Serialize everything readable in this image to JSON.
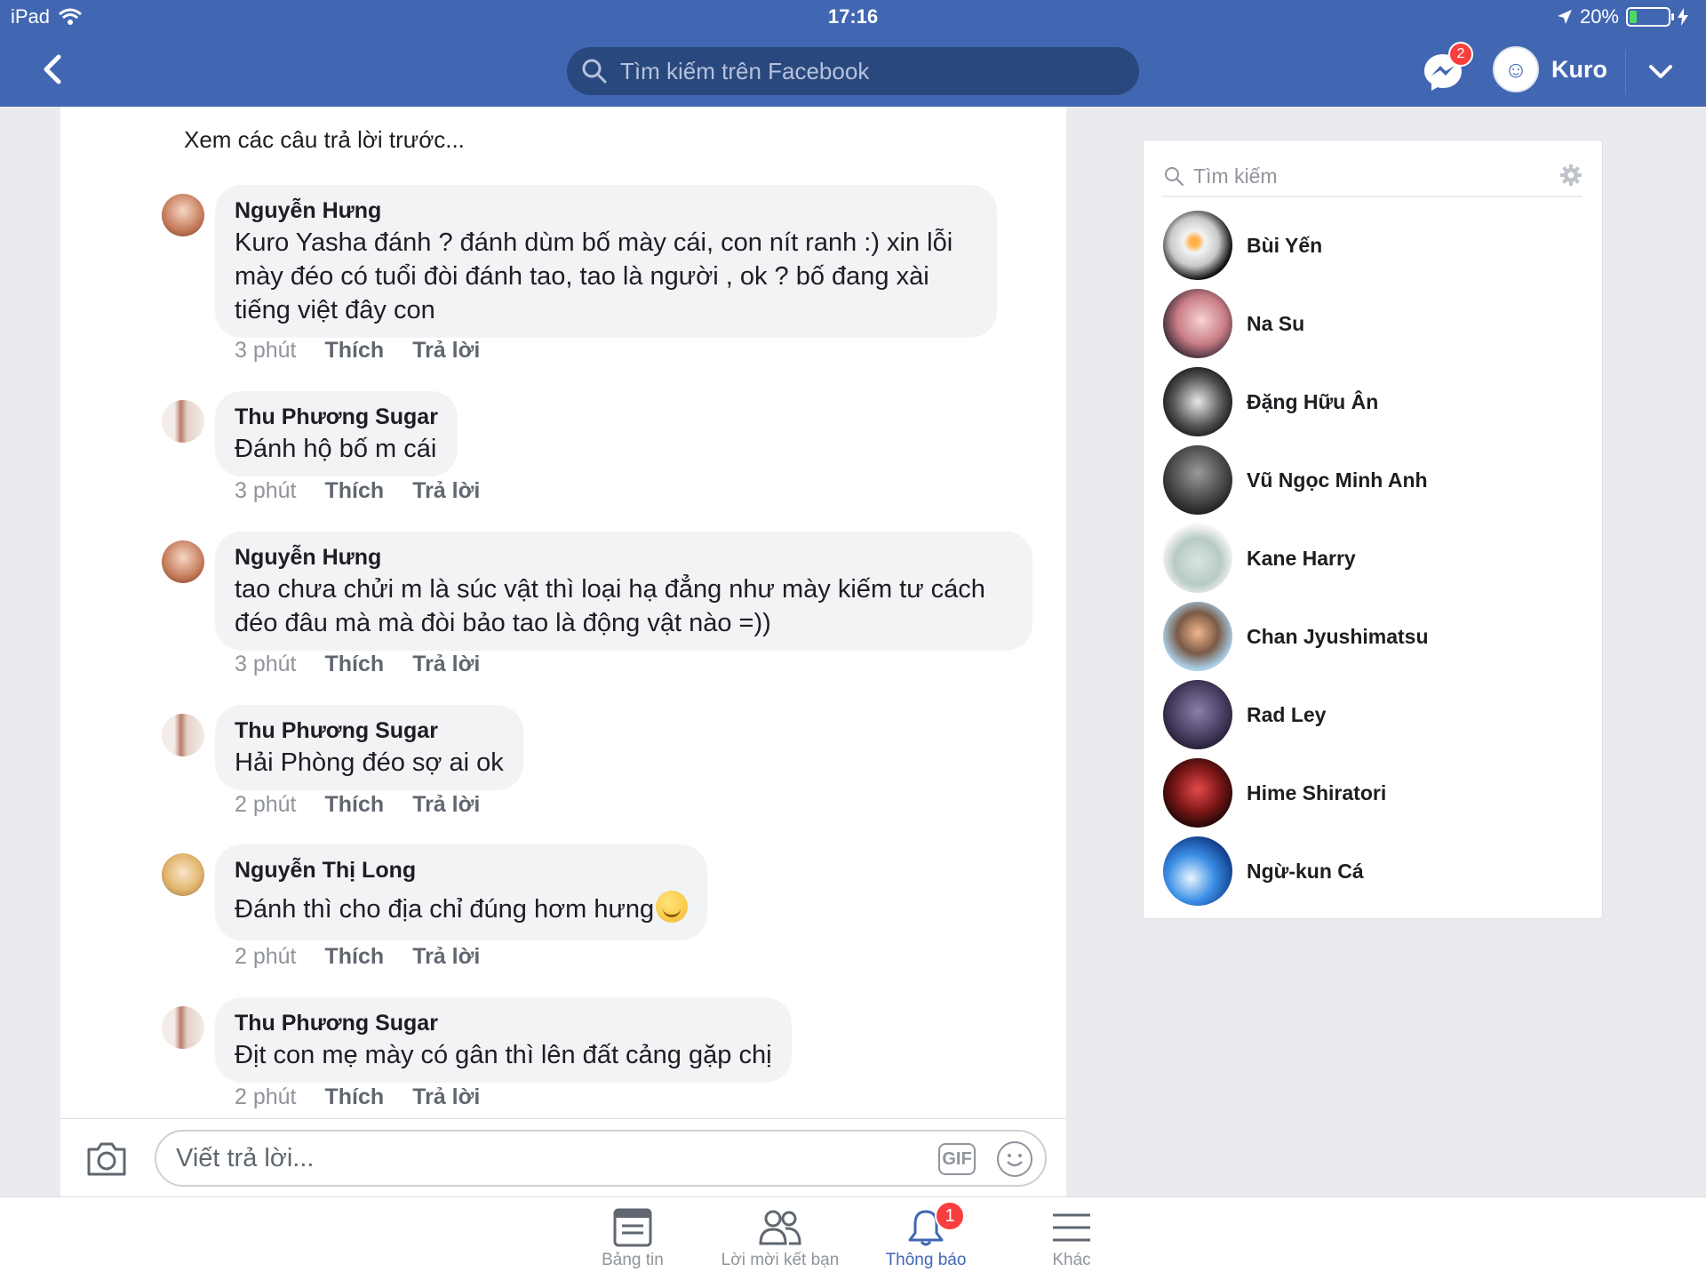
{
  "status": {
    "device": "iPad",
    "time": "17:16",
    "battery": "20%",
    "battery_level": 0.2
  },
  "nav": {
    "search_placeholder": "Tìm kiếm trên Facebook",
    "messenger_badge": "2",
    "profile_name": "Kuro"
  },
  "comments": {
    "view_previous": "Xem các câu trả lời trước...",
    "like_label": "Thích",
    "reply_label": "Trả lời",
    "items": [
      {
        "name": "Nguyễn Hưng",
        "text": "Kuro Yasha đánh ? đánh dùm bố mày cái, con nít ranh :) xin lỗi mày đéo có tuổi đòi đánh tao, tao là người , ok ?  bố đang xài tiếng việt đây con",
        "time": "3 phút"
      },
      {
        "name": "Thu Phương Sugar",
        "text": "Đánh hộ bố m cái",
        "time": "3 phút"
      },
      {
        "name": "Nguyễn Hưng",
        "text": "tao chưa chửi m là súc vật thì loại hạ đẳng như mày kiếm tư cách đéo đâu mà mà đòi bảo tao là động vật nào =))",
        "time": "3 phút"
      },
      {
        "name": "Thu Phương Sugar",
        "text": "Hải Phòng đéo sợ ai ok",
        "time": "2 phút"
      },
      {
        "name": "Nguyễn Thị Long",
        "text": "Đánh thì cho địa chỉ đúng hơm hưng",
        "time": "2 phút"
      },
      {
        "name": "Thu Phương Sugar",
        "text": "Địt con mẹ mày có gân thì lên đất cảng gặp chị",
        "time": "2 phút"
      }
    ]
  },
  "composer": {
    "placeholder": "Viết trả lời...",
    "gif_label": "GIF"
  },
  "sidebar": {
    "search_placeholder": "Tìm kiếm",
    "contacts": [
      {
        "name": "Bùi Yến"
      },
      {
        "name": "Na Su"
      },
      {
        "name": "Đặng Hữu Ân"
      },
      {
        "name": "Vũ Ngọc Minh Anh"
      },
      {
        "name": "Kane Harry"
      },
      {
        "name": "Chan Jyushimatsu"
      },
      {
        "name": "Rad Ley"
      },
      {
        "name": "Hime Shiratori"
      },
      {
        "name": "Ngừ-kun Cá"
      }
    ]
  },
  "tabs": [
    {
      "label": "Bảng tin",
      "icon": "news-feed-icon"
    },
    {
      "label": "Lời mời kết bạn",
      "icon": "friend-requests-icon"
    },
    {
      "label": "Thông báo",
      "icon": "notifications-icon",
      "badge": "1",
      "active": true
    },
    {
      "label": "Khác",
      "icon": "menu-icon"
    }
  ],
  "colors": {
    "brand": "#4267b2",
    "badge": "#fa3e3e",
    "battery": "#4cd964"
  }
}
